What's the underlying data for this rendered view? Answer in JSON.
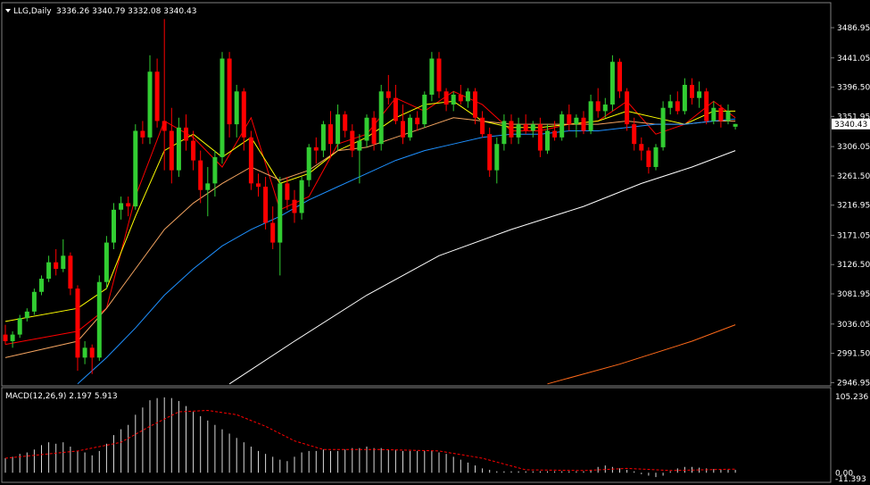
{
  "chart_data": {
    "type": "candlestick",
    "title": "LLG,Daily",
    "ohlc_text": "3336.26 3340.79 3332.08 3340.43",
    "last_price_label": "3340.43",
    "y_ticks": [
      "3486.95",
      "3441.05",
      "3396.50",
      "3351.95",
      "3306.05",
      "3261.50",
      "3216.95",
      "3171.05",
      "3126.50",
      "3081.95",
      "3036.05",
      "2991.50",
      "2946.95"
    ],
    "y_tick_values": [
      3486.95,
      3441.05,
      3396.5,
      3351.95,
      3306.05,
      3261.5,
      3216.95,
      3171.05,
      3126.5,
      3081.95,
      3036.05,
      2991.5,
      2946.95
    ],
    "ylim": [
      2942,
      3525
    ],
    "last_price": 3340.43,
    "colors": {
      "up": "#32cd32",
      "down": "#ff0000",
      "ma_fast": "#ff0000",
      "ma_yellow": "#ffff00",
      "ma_salmon": "#f4a460",
      "ma_blue": "#1e90ff",
      "ma_white": "#ffffff",
      "ma_orange": "#ff6a1a",
      "macd_hist": "#d8d8d8",
      "macd_signal": "#ff0000",
      "grid": "#808080"
    },
    "candles": [
      [
        3020,
        3035,
        3005,
        3010
      ],
      [
        3010,
        3025,
        3000,
        3020
      ],
      [
        3020,
        3050,
        3015,
        3045
      ],
      [
        3045,
        3060,
        3040,
        3055
      ],
      [
        3055,
        3090,
        3050,
        3085
      ],
      [
        3085,
        3110,
        3080,
        3105
      ],
      [
        3105,
        3140,
        3100,
        3130
      ],
      [
        3130,
        3150,
        3110,
        3120
      ],
      [
        3120,
        3165,
        3115,
        3140
      ],
      [
        3140,
        3145,
        3080,
        3090
      ],
      [
        3090,
        3095,
        2965,
        2985
      ],
      [
        2985,
        3010,
        2975,
        3000
      ],
      [
        3000,
        3005,
        2960,
        2985
      ],
      [
        2985,
        3110,
        2980,
        3100
      ],
      [
        3100,
        3170,
        3090,
        3160
      ],
      [
        3160,
        3220,
        3150,
        3210
      ],
      [
        3210,
        3230,
        3195,
        3220
      ],
      [
        3220,
        3230,
        3200,
        3215
      ],
      [
        3215,
        3340,
        3210,
        3330
      ],
      [
        3330,
        3345,
        3310,
        3320
      ],
      [
        3320,
        3445,
        3310,
        3420
      ],
      [
        3420,
        3440,
        3335,
        3345
      ],
      [
        3345,
        3500,
        3270,
        3330
      ],
      [
        3330,
        3365,
        3250,
        3270
      ],
      [
        3270,
        3350,
        3260,
        3335
      ],
      [
        3335,
        3355,
        3300,
        3315
      ],
      [
        3315,
        3330,
        3270,
        3285
      ],
      [
        3285,
        3300,
        3220,
        3240
      ],
      [
        3240,
        3275,
        3200,
        3250
      ],
      [
        3250,
        3300,
        3230,
        3290
      ],
      [
        3290,
        3450,
        3280,
        3440
      ],
      [
        3440,
        3450,
        3320,
        3340
      ],
      [
        3340,
        3400,
        3320,
        3390
      ],
      [
        3390,
        3395,
        3300,
        3320
      ],
      [
        3320,
        3330,
        3240,
        3250
      ],
      [
        3250,
        3265,
        3230,
        3245
      ],
      [
        3245,
        3260,
        3180,
        3190
      ],
      [
        3190,
        3215,
        3150,
        3160
      ],
      [
        3160,
        3260,
        3110,
        3250
      ],
      [
        3250,
        3260,
        3210,
        3225
      ],
      [
        3225,
        3240,
        3190,
        3205
      ],
      [
        3205,
        3260,
        3195,
        3255
      ],
      [
        3255,
        3310,
        3245,
        3305
      ],
      [
        3305,
        3320,
        3280,
        3300
      ],
      [
        3300,
        3345,
        3290,
        3340
      ],
      [
        3340,
        3360,
        3290,
        3310
      ],
      [
        3310,
        3370,
        3300,
        3355
      ],
      [
        3355,
        3360,
        3320,
        3330
      ],
      [
        3330,
        3340,
        3290,
        3300
      ],
      [
        3300,
        3325,
        3250,
        3315
      ],
      [
        3315,
        3355,
        3305,
        3350
      ],
      [
        3350,
        3360,
        3300,
        3310
      ],
      [
        3310,
        3400,
        3300,
        3390
      ],
      [
        3390,
        3415,
        3370,
        3380
      ],
      [
        3380,
        3400,
        3340,
        3345
      ],
      [
        3345,
        3370,
        3310,
        3320
      ],
      [
        3320,
        3355,
        3315,
        3350
      ],
      [
        3350,
        3360,
        3330,
        3340
      ],
      [
        3340,
        3390,
        3335,
        3385
      ],
      [
        3385,
        3450,
        3375,
        3440
      ],
      [
        3440,
        3450,
        3380,
        3390
      ],
      [
        3390,
        3395,
        3360,
        3370
      ],
      [
        3370,
        3390,
        3360,
        3385
      ],
      [
        3385,
        3400,
        3370,
        3375
      ],
      [
        3375,
        3395,
        3365,
        3390
      ],
      [
        3390,
        3395,
        3340,
        3350
      ],
      [
        3350,
        3360,
        3320,
        3325
      ],
      [
        3325,
        3335,
        3260,
        3270
      ],
      [
        3270,
        3320,
        3250,
        3310
      ],
      [
        3310,
        3355,
        3300,
        3345
      ],
      [
        3345,
        3355,
        3310,
        3320
      ],
      [
        3320,
        3350,
        3310,
        3340
      ],
      [
        3340,
        3355,
        3325,
        3330
      ],
      [
        3330,
        3345,
        3320,
        3340
      ],
      [
        3340,
        3350,
        3290,
        3300
      ],
      [
        3300,
        3340,
        3295,
        3330
      ],
      [
        3330,
        3345,
        3315,
        3320
      ],
      [
        3320,
        3360,
        3315,
        3355
      ],
      [
        3355,
        3370,
        3330,
        3340
      ],
      [
        3340,
        3355,
        3320,
        3350
      ],
      [
        3350,
        3360,
        3325,
        3330
      ],
      [
        3330,
        3385,
        3325,
        3375
      ],
      [
        3375,
        3395,
        3350,
        3360
      ],
      [
        3360,
        3380,
        3350,
        3370
      ],
      [
        3370,
        3445,
        3360,
        3435
      ],
      [
        3435,
        3440,
        3380,
        3390
      ],
      [
        3390,
        3395,
        3330,
        3340
      ],
      [
        3340,
        3350,
        3300,
        3310
      ],
      [
        3310,
        3320,
        3285,
        3300
      ],
      [
        3300,
        3305,
        3265,
        3275
      ],
      [
        3275,
        3310,
        3270,
        3305
      ],
      [
        3305,
        3375,
        3300,
        3365
      ],
      [
        3365,
        3385,
        3355,
        3375
      ],
      [
        3375,
        3390,
        3355,
        3360
      ],
      [
        3360,
        3410,
        3355,
        3400
      ],
      [
        3400,
        3410,
        3370,
        3380
      ],
      [
        3380,
        3405,
        3365,
        3390
      ],
      [
        3390,
        3395,
        3340,
        3345
      ],
      [
        3345,
        3375,
        3340,
        3365
      ],
      [
        3365,
        3370,
        3335,
        3345
      ],
      [
        3345,
        3370,
        3340,
        3360
      ],
      [
        3336.26,
        3340.79,
        3332.08,
        3340.43
      ]
    ],
    "ma_series": {
      "ma_fast": [
        [
          0,
          3005
        ],
        [
          10,
          3025
        ],
        [
          14,
          3060
        ],
        [
          18,
          3230
        ],
        [
          22,
          3345
        ],
        [
          26,
          3320
        ],
        [
          30,
          3275
        ],
        [
          34,
          3350
        ],
        [
          38,
          3210
        ],
        [
          42,
          3230
        ],
        [
          46,
          3310
        ],
        [
          50,
          3325
        ],
        [
          54,
          3380
        ],
        [
          58,
          3360
        ],
        [
          62,
          3390
        ],
        [
          66,
          3370
        ],
        [
          70,
          3330
        ],
        [
          74,
          3330
        ],
        [
          78,
          3340
        ],
        [
          82,
          3345
        ],
        [
          86,
          3375
        ],
        [
          90,
          3325
        ],
        [
          94,
          3340
        ],
        [
          98,
          3375
        ],
        [
          101,
          3350
        ]
      ],
      "ma_yellow": [
        [
          0,
          3040
        ],
        [
          10,
          3060
        ],
        [
          14,
          3090
        ],
        [
          18,
          3200
        ],
        [
          22,
          3300
        ],
        [
          26,
          3325
        ],
        [
          30,
          3290
        ],
        [
          34,
          3320
        ],
        [
          38,
          3250
        ],
        [
          42,
          3265
        ],
        [
          46,
          3300
        ],
        [
          50,
          3320
        ],
        [
          54,
          3350
        ],
        [
          58,
          3370
        ],
        [
          62,
          3375
        ],
        [
          66,
          3345
        ],
        [
          70,
          3335
        ],
        [
          74,
          3335
        ],
        [
          78,
          3340
        ],
        [
          82,
          3345
        ],
        [
          86,
          3360
        ],
        [
          90,
          3350
        ],
        [
          94,
          3340
        ],
        [
          98,
          3360
        ],
        [
          101,
          3360
        ]
      ],
      "ma_salmon": [
        [
          0,
          2985
        ],
        [
          10,
          3010
        ],
        [
          14,
          3060
        ],
        [
          18,
          3120
        ],
        [
          22,
          3180
        ],
        [
          26,
          3220
        ],
        [
          30,
          3250
        ],
        [
          34,
          3275
        ],
        [
          38,
          3255
        ],
        [
          42,
          3270
        ],
        [
          46,
          3300
        ],
        [
          50,
          3305
        ],
        [
          54,
          3320
        ],
        [
          58,
          3335
        ],
        [
          62,
          3350
        ],
        [
          66,
          3345
        ],
        [
          70,
          3340
        ],
        [
          74,
          3340
        ],
        [
          78,
          3340
        ],
        [
          82,
          3340
        ],
        [
          86,
          3345
        ],
        [
          90,
          3340
        ],
        [
          94,
          3340
        ],
        [
          98,
          3345
        ],
        [
          101,
          3345
        ]
      ],
      "ma_blue": [
        [
          10,
          2945
        ],
        [
          14,
          2985
        ],
        [
          18,
          3030
        ],
        [
          22,
          3080
        ],
        [
          26,
          3120
        ],
        [
          30,
          3155
        ],
        [
          34,
          3180
        ],
        [
          38,
          3200
        ],
        [
          42,
          3225
        ],
        [
          46,
          3245
        ],
        [
          50,
          3265
        ],
        [
          54,
          3285
        ],
        [
          58,
          3300
        ],
        [
          62,
          3310
        ],
        [
          66,
          3320
        ],
        [
          70,
          3325
        ],
        [
          74,
          3325
        ],
        [
          78,
          3330
        ],
        [
          82,
          3330
        ],
        [
          86,
          3335
        ],
        [
          90,
          3340
        ],
        [
          94,
          3340
        ],
        [
          98,
          3345
        ],
        [
          101,
          3348
        ]
      ],
      "ma_white": [
        [
          31,
          2945
        ],
        [
          40,
          3010
        ],
        [
          50,
          3080
        ],
        [
          60,
          3140
        ],
        [
          70,
          3180
        ],
        [
          80,
          3215
        ],
        [
          88,
          3250
        ],
        [
          95,
          3275
        ],
        [
          101,
          3300
        ]
      ],
      "ma_orange": [
        [
          75,
          2945
        ],
        [
          85,
          2975
        ],
        [
          95,
          3010
        ],
        [
          101,
          3035
        ]
      ]
    },
    "macd": {
      "label": "MACD(12,26,9) 2.197 5.913",
      "y_ticks": [
        "105.236",
        "0.00",
        "-11.393"
      ],
      "ylim": [
        -12,
        110
      ],
      "histogram": [
        20,
        22,
        26,
        28,
        32,
        38,
        42,
        40,
        42,
        36,
        30,
        28,
        24,
        30,
        40,
        52,
        60,
        66,
        80,
        90,
        100,
        103,
        104,
        103,
        99,
        92,
        84,
        78,
        72,
        66,
        60,
        54,
        48,
        42,
        36,
        30,
        26,
        22,
        18,
        16,
        22,
        28,
        30,
        30,
        32,
        30,
        30,
        32,
        34,
        34,
        36,
        34,
        34,
        32,
        32,
        30,
        30,
        30,
        30,
        30,
        28,
        26,
        22,
        18,
        14,
        10,
        6,
        4,
        2,
        2,
        2,
        2,
        2,
        2,
        2,
        2,
        2,
        2,
        2,
        2,
        2,
        4,
        8,
        10,
        8,
        6,
        4,
        2,
        -2,
        -4,
        -6,
        -4,
        2,
        6,
        8,
        8,
        7,
        6,
        5,
        4,
        4,
        4
      ],
      "signal": [
        [
          0,
          20
        ],
        [
          10,
          30
        ],
        [
          16,
          42
        ],
        [
          20,
          64
        ],
        [
          24,
          84
        ],
        [
          28,
          86
        ],
        [
          32,
          80
        ],
        [
          36,
          64
        ],
        [
          40,
          44
        ],
        [
          44,
          32
        ],
        [
          52,
          32
        ],
        [
          60,
          30
        ],
        [
          66,
          20
        ],
        [
          72,
          4
        ],
        [
          80,
          3
        ],
        [
          86,
          6
        ],
        [
          92,
          3
        ],
        [
          101,
          5
        ]
      ]
    }
  }
}
